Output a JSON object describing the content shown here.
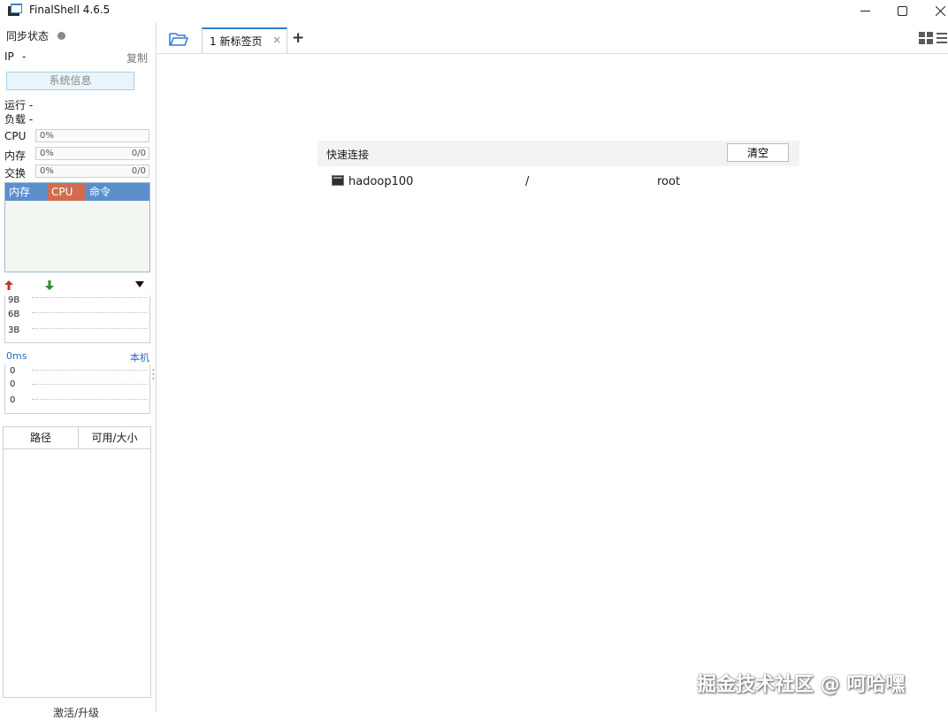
{
  "window": {
    "title": "FinalShell 4.6.5",
    "icon": "finalshell-app-icon",
    "controls": [
      "minimize-icon",
      "maximize-icon",
      "close-icon"
    ]
  },
  "sidebar": {
    "sync_label": "同步状态",
    "ip_label": "IP",
    "ip_value": "-",
    "copy_label": "复制",
    "sysinfo_button": "系统信息",
    "run_label": "运行 -",
    "load_label": "负载 -",
    "meters": [
      {
        "label": "CPU",
        "percent": "0%",
        "extra": ""
      },
      {
        "label": "内存",
        "percent": "0%",
        "extra": "0/0"
      },
      {
        "label": "交换",
        "percent": "0%",
        "extra": "0/0"
      }
    ],
    "process_tabs": {
      "mem": "内存",
      "cpu": "CPU",
      "cmd": "命令"
    },
    "network": {
      "ticks": [
        "9B",
        "6B",
        "3B"
      ],
      "up_color": "#c0392b",
      "down_color": "#2e8b2e"
    },
    "ping": {
      "latency": "0ms",
      "host": "本机",
      "ticks": [
        "0",
        "0",
        "0"
      ]
    },
    "disk": {
      "col_path": "路径",
      "col_size": "可用/大小"
    },
    "activate_label": "激活/升级"
  },
  "tabs": {
    "active_label": "1 新标签页",
    "close_glyph": "×",
    "add_glyph": "+",
    "accent": "#2f7fd4"
  },
  "quick_connect": {
    "title": "快速连接",
    "clear_button": "清空",
    "rows": [
      {
        "name": "hadoop100",
        "path": "/",
        "user": "root"
      }
    ]
  },
  "watermark": "掘金技术社区 @ 呵哈嘿"
}
